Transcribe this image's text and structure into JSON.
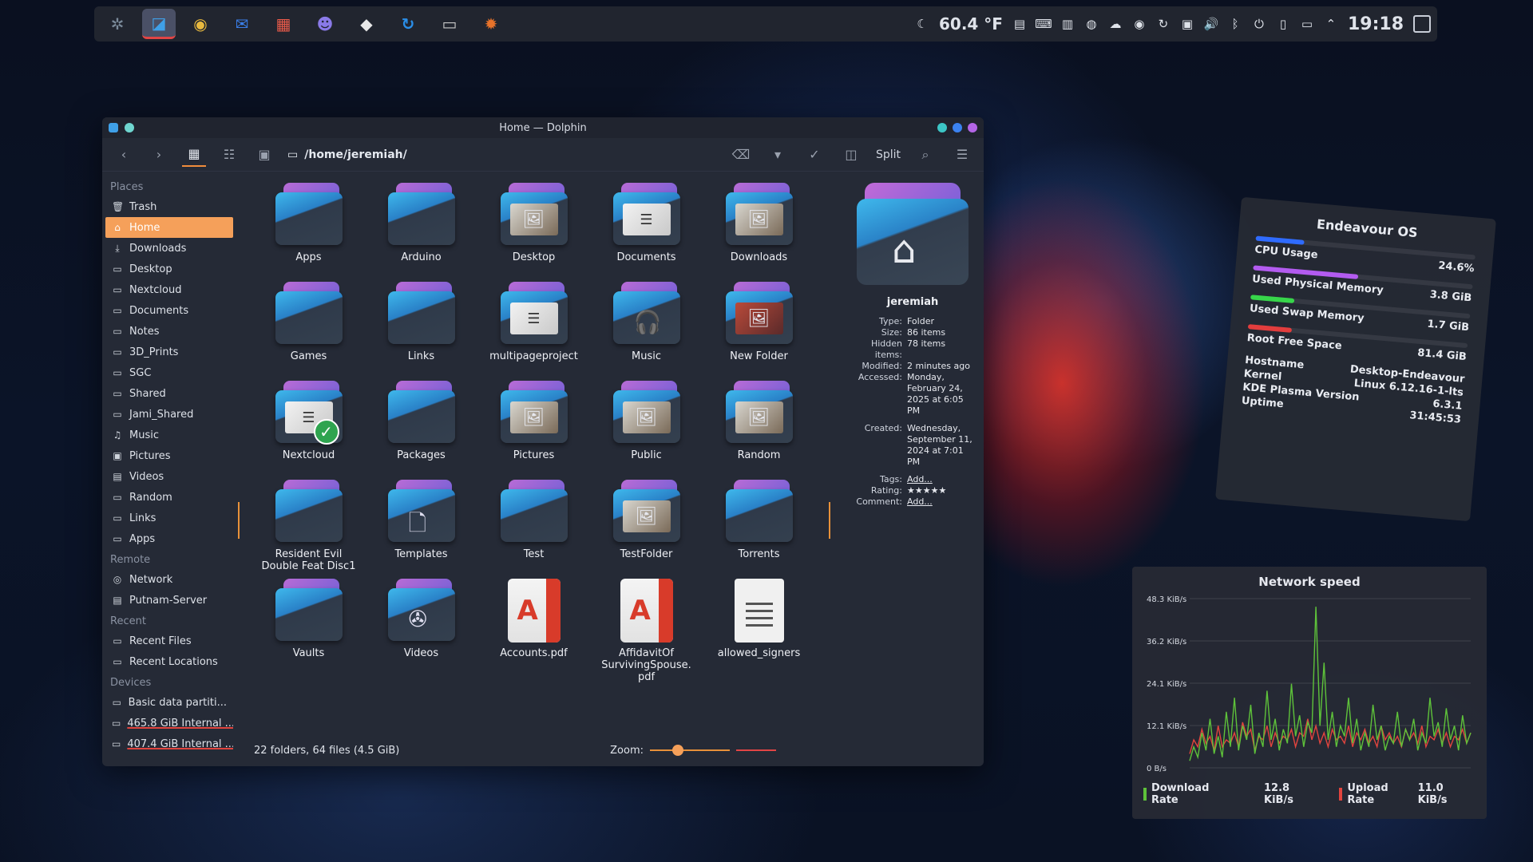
{
  "panel": {
    "apps": [
      {
        "name": "kde-gear-icon",
        "glyph": "✲",
        "color": "#7a8a9a"
      },
      {
        "name": "dolphin-icon",
        "glyph": "◪",
        "color": "#3fa0e8",
        "active": true
      },
      {
        "name": "chrome-icon",
        "glyph": "◉",
        "color": "#e8b93f"
      },
      {
        "name": "thunderbird-icon",
        "glyph": "✉",
        "color": "#3a7ee8"
      },
      {
        "name": "terminal-icon",
        "glyph": "▦",
        "color": "#e85a4a"
      },
      {
        "name": "game-icon",
        "glyph": "☻",
        "color": "#8a7ae8"
      },
      {
        "name": "obsidian-icon",
        "glyph": "◆",
        "color": "#e8e8e8"
      },
      {
        "name": "synology-icon",
        "glyph": "↻",
        "color": "#2a8ee8"
      },
      {
        "name": "monitor-icon",
        "glyph": "▭",
        "color": "#c8c8c8"
      },
      {
        "name": "settings-icon",
        "glyph": "✹",
        "color": "#e8732a"
      }
    ],
    "temperature": "60.4 °F",
    "clock": "19:18"
  },
  "window": {
    "title": "Home — Dolphin",
    "path": "/home/jeremiah/",
    "split_label": "Split"
  },
  "sidebar": {
    "places_title": "Places",
    "places": [
      {
        "label": "Trash",
        "icon": "🗑"
      },
      {
        "label": "Home",
        "icon": "⌂",
        "selected": true
      },
      {
        "label": "Downloads",
        "icon": "⤓"
      },
      {
        "label": "Desktop",
        "icon": "▭"
      },
      {
        "label": "Nextcloud",
        "icon": "▭"
      },
      {
        "label": "Documents",
        "icon": "▭"
      },
      {
        "label": "Notes",
        "icon": "▭"
      },
      {
        "label": "3D_Prints",
        "icon": "▭"
      },
      {
        "label": "SGC",
        "icon": "▭"
      },
      {
        "label": "Shared",
        "icon": "▭"
      },
      {
        "label": "Jami_Shared",
        "icon": "▭"
      },
      {
        "label": "Music",
        "icon": "♫"
      },
      {
        "label": "Pictures",
        "icon": "▣"
      },
      {
        "label": "Videos",
        "icon": "▤"
      },
      {
        "label": "Random",
        "icon": "▭"
      },
      {
        "label": "Links",
        "icon": "▭"
      },
      {
        "label": "Apps",
        "icon": "▭"
      }
    ],
    "remote_title": "Remote",
    "remote": [
      {
        "label": "Network",
        "icon": "◎"
      },
      {
        "label": "Putnam-Server",
        "icon": "▤"
      }
    ],
    "recent_title": "Recent",
    "recent": [
      {
        "label": "Recent Files",
        "icon": "▭"
      },
      {
        "label": "Recent Locations",
        "icon": "▭"
      }
    ],
    "devices_title": "Devices",
    "devices": [
      {
        "label": "Basic data partiti...",
        "icon": "▭"
      },
      {
        "label": "465.8 GiB Internal ...",
        "icon": "▭",
        "usage": true
      },
      {
        "label": "407.4 GiB Internal ...",
        "icon": "▭",
        "usage": true
      }
    ]
  },
  "files": [
    {
      "name": "Apps",
      "kind": "folder"
    },
    {
      "name": "Arduino",
      "kind": "folder"
    },
    {
      "name": "Desktop",
      "kind": "folder",
      "badge": "pics",
      "glyph": "🖼"
    },
    {
      "name": "Documents",
      "kind": "folder",
      "badge": "docs",
      "glyph": "☰"
    },
    {
      "name": "Downloads",
      "kind": "folder",
      "badge": "pics",
      "glyph": "🖼"
    },
    {
      "name": "Games",
      "kind": "folder"
    },
    {
      "name": "Links",
      "kind": "folder"
    },
    {
      "name": "multipageproject",
      "kind": "folder",
      "badge": "docs",
      "glyph": "☰"
    },
    {
      "name": "Music",
      "kind": "folder",
      "glyph": "🎧"
    },
    {
      "name": "New Folder",
      "kind": "folder",
      "badge": "red",
      "glyph": "🖼"
    },
    {
      "name": "Nextcloud",
      "kind": "folder",
      "badge": "docs",
      "glyph": "☰",
      "check": true
    },
    {
      "name": "Packages",
      "kind": "folder"
    },
    {
      "name": "Pictures",
      "kind": "folder",
      "badge": "pics",
      "glyph": "🖼"
    },
    {
      "name": "Public",
      "kind": "folder",
      "badge": "pics",
      "glyph": "🖼"
    },
    {
      "name": "Random",
      "kind": "folder",
      "badge": "pics",
      "glyph": "🖼"
    },
    {
      "name": "Resident Evil Double Feat Disc1",
      "kind": "folder"
    },
    {
      "name": "Templates",
      "kind": "folder",
      "glyph": "🗋"
    },
    {
      "name": "Test",
      "kind": "folder"
    },
    {
      "name": "TestFolder",
      "kind": "folder",
      "badge": "pics",
      "glyph": "🖼"
    },
    {
      "name": "Torrents",
      "kind": "folder"
    },
    {
      "name": "Vaults",
      "kind": "folder"
    },
    {
      "name": "Videos",
      "kind": "folder",
      "glyph": "✇"
    },
    {
      "name": "Accounts.pdf",
      "kind": "pdf"
    },
    {
      "name": "AffidavitOf SurvivingSpouse. pdf",
      "kind": "pdf"
    },
    {
      "name": "allowed_signers",
      "kind": "text"
    }
  ],
  "info_panel": {
    "owner": "jeremiah",
    "meta": [
      {
        "k": "Type:",
        "v": "Folder"
      },
      {
        "k": "Size:",
        "v": "86 items"
      },
      {
        "k": "Hidden items:",
        "v": "78 items"
      },
      {
        "k": "Modified:",
        "v": "2 minutes ago"
      },
      {
        "k": "Accessed:",
        "v": "Monday, February 24, 2025 at 6:05 PM"
      },
      {
        "k": "Created:",
        "v": "Wednesday, September 11, 2024 at 7:01 PM"
      },
      {
        "k": "Tags:",
        "v": "Add...",
        "link": true
      },
      {
        "k": "Rating:",
        "v": "★★★★★"
      },
      {
        "k": "Comment:",
        "v": "Add...",
        "link": true
      }
    ]
  },
  "status": {
    "summary": "22 folders, 64 files (4.5 GiB)",
    "zoom_label": "Zoom:",
    "zoom_fraction": 0.35
  },
  "sysinfo": {
    "title": "Endeavour OS",
    "stats": [
      {
        "label": "CPU Usage",
        "value": "24.6%",
        "fraction": 0.22,
        "color": "#2f6bff"
      },
      {
        "label": "Used Physical Memory",
        "value": "3.8 GiB",
        "fraction": 0.48,
        "color": "#b35bf0"
      },
      {
        "label": "Used Swap Memory",
        "value": "1.7 GiB",
        "fraction": 0.2,
        "color": "#37d64a"
      },
      {
        "label": "Root Free Space",
        "value": "81.4 GiB",
        "fraction": 0.2,
        "color": "#e23d3d"
      }
    ],
    "hostname_label": "Hostname",
    "hostname": "Desktop-Endeavour",
    "kernel_label": "Kernel",
    "kernel": "Linux 6.12.16-1-lts",
    "plasma_label": "KDE Plasma Version",
    "plasma": "6.3.1",
    "uptime_label": "Uptime",
    "uptime": "31:45:53"
  },
  "chart_data": {
    "type": "line",
    "title": "Network speed",
    "y_ticks": [
      "48.3 KiB/s",
      "36.2 KiB/s",
      "24.1 KiB/s",
      "12.1 KiB/s",
      "0 B/s"
    ],
    "ylim": [
      0,
      48.3
    ],
    "series": [
      {
        "name": "Download Rate",
        "color": "#5ec23a",
        "current": "12.8 KiB/s",
        "values": [
          2,
          6,
          3,
          10,
          5,
          14,
          4,
          9,
          3,
          16,
          6,
          20,
          5,
          12,
          8,
          18,
          4,
          10,
          6,
          22,
          8,
          14,
          5,
          11,
          7,
          24,
          9,
          15,
          6,
          13,
          10,
          46,
          12,
          30,
          8,
          16,
          6,
          12,
          9,
          20,
          7,
          14,
          5,
          10,
          6,
          18,
          8,
          12,
          5,
          9,
          7,
          16,
          6,
          11,
          8,
          14,
          5,
          10,
          7,
          20,
          9,
          13,
          6,
          17,
          8,
          12,
          5,
          15,
          7,
          10
        ]
      },
      {
        "name": "Upload Rate",
        "color": "#e2443e",
        "current": "11.0 KiB/s",
        "values": [
          4,
          8,
          6,
          11,
          7,
          9,
          5,
          12,
          6,
          8,
          7,
          10,
          6,
          13,
          9,
          11,
          5,
          9,
          8,
          12,
          6,
          10,
          7,
          9,
          8,
          11,
          6,
          10,
          9,
          14,
          8,
          12,
          7,
          10,
          6,
          11,
          8,
          9,
          7,
          12,
          6,
          10,
          8,
          11,
          7,
          9,
          6,
          12,
          8,
          10,
          7,
          9,
          6,
          11,
          8,
          10,
          7,
          12,
          6,
          9,
          8,
          11,
          7,
          10,
          6,
          9,
          8,
          11,
          7,
          10
        ]
      }
    ]
  }
}
